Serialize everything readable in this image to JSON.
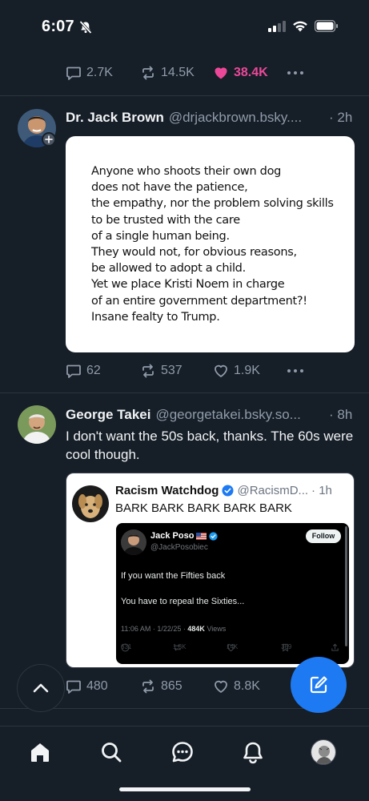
{
  "status_bar": {
    "time": "6:07"
  },
  "colors": {
    "background": "#161e27",
    "like": "#ec4899",
    "accent": "#1d7af2",
    "muted": "#8f9bab"
  },
  "prev_post": {
    "replies": "2.7K",
    "reposts": "14.5K",
    "likes": "38.4K",
    "liked": true
  },
  "posts": [
    {
      "display_name": "Dr. Jack Brown",
      "handle": "@drjackbrown.bsky....",
      "time": "· 2h",
      "image_text": "Anyone who shoots their own dog\ndoes not have the patience,\nthe empathy, nor the problem solving skills\nto be trusted with the care\nof a single human being.\nThey would not, for obvious reasons,\nbe allowed to adopt a child.\nYet we place Kristi Noem in charge\nof an entire government department?!\nInsane fealty to Trump.",
      "replies": "62",
      "reposts": "537",
      "likes": "1.9K"
    },
    {
      "display_name": "George Takei",
      "handle": "@georgetakei.bsky.so...",
      "time": "· 8h",
      "text": "I don't want the 50s back, thanks. The 60s were cool though.",
      "quote": {
        "display_name": "Racism Watchdog",
        "handle": "@RacismD...",
        "time": "· 1h",
        "text": "BARK BARK BARK BARK BARK",
        "embedded_tweet": {
          "name": "Jack Poso",
          "handle": "@JackPosobiec",
          "follow_label": "Follow",
          "line1": "If you want the Fifties back",
          "line2": "You have to repeal the Sixties...",
          "meta_time": "11:06 AM · 1/22/25 ·",
          "views_count": "484K",
          "views_label": "Views",
          "replies": "631",
          "reposts": "1.3K",
          "likes": "14K",
          "bookmarks": "369"
        }
      },
      "replies": "480",
      "reposts": "865",
      "likes": "8.8K"
    }
  ],
  "tab_bar": {
    "items": [
      {
        "icon": "home-icon",
        "active": true
      },
      {
        "icon": "search-icon",
        "active": false
      },
      {
        "icon": "chat-icon",
        "active": false
      },
      {
        "icon": "bell-icon",
        "active": false
      },
      {
        "icon": "profile-avatar",
        "active": false
      }
    ]
  }
}
